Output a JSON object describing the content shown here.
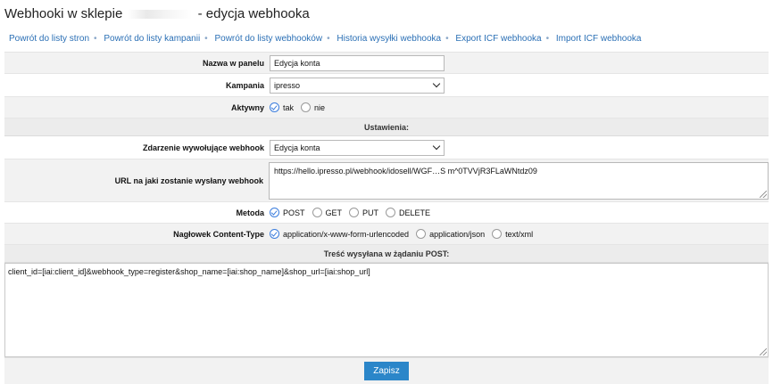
{
  "page": {
    "title_prefix": "Webhooki w sklepie",
    "title_suffix": "- edycja webhooka"
  },
  "nav": [
    "Powrót do listy stron",
    "Powrót do listy kampanii",
    "Powrót do listy webhooków",
    "Historia wysyłki webhooka",
    "Export ICF webhooka",
    "Import ICF webhooka"
  ],
  "form": {
    "name_label": "Nazwa w panelu",
    "name_value": "Edycja konta",
    "campaign_label": "Kampania",
    "campaign_value": "ipresso",
    "active_label": "Aktywny",
    "active_yes": "tak",
    "active_no": "nie",
    "settings_header": "Ustawienia:",
    "event_label": "Zdarzenie wywołujące webhook",
    "event_value": "Edycja konta",
    "url_label": "URL na jaki zostanie wysłany webhook",
    "url_value": "https://hello.ipresso.pl/webhook/idosell/WGF…S m^0TVVjR3FLaWNtdz09",
    "method_label": "Metoda",
    "methods": [
      "POST",
      "GET",
      "PUT",
      "DELETE"
    ],
    "method_selected": "POST",
    "content_type_label": "Nagłowek Content-Type",
    "content_types": [
      "application/x-www-form-urlencoded",
      "application/json",
      "text/xml"
    ],
    "content_type_selected": "application/x-www-form-urlencoded",
    "body_header": "Treść wysyłana w żądaniu POST:",
    "body_value": "client_id=[iai:client_id]&webhook_type=register&shop_name=[iai:shop_name]&shop_url=[iai:shop_url]",
    "save_label": "Zapisz"
  },
  "colors": {
    "link": "#2a6fb5",
    "button": "#2b86c9",
    "radio_active": "#3b7ddd"
  }
}
